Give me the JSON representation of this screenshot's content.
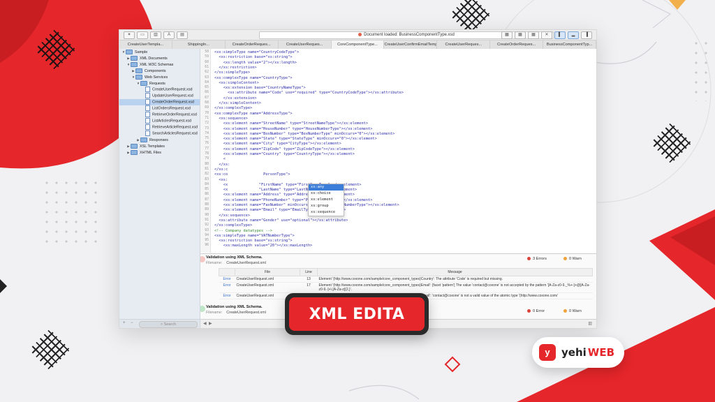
{
  "colors": {
    "accent": "#e5262a",
    "background": "#f1f1f3",
    "selection": "#3b7dd8"
  },
  "window": {
    "doc_status": "Document loaded: BusinessComponentType.xsd",
    "tabs": [
      "CreateUserTempla...",
      "ShippingIn...",
      "CreateOrderReques...",
      "CreateUserReques...",
      "CoreComponentType...",
      "CreateUserConfirmEmailTemplat...",
      "CreateUserReques...",
      "CreateOrderReques...",
      "BusinessComponentTyp..."
    ]
  },
  "sidebar": {
    "tree": [
      {
        "label": "Sample",
        "indent": 0,
        "type": "folder",
        "arrow": "▼"
      },
      {
        "label": "XML Documents",
        "indent": 1,
        "type": "folder",
        "arrow": "▶"
      },
      {
        "label": "XML W3C Schemas",
        "indent": 1,
        "type": "folder",
        "arrow": "▼"
      },
      {
        "label": "Components",
        "indent": 2,
        "type": "folder",
        "arrow": "▶"
      },
      {
        "label": "Web Services",
        "indent": 2,
        "type": "folder",
        "arrow": "▼"
      },
      {
        "label": "Requests",
        "indent": 3,
        "type": "folder",
        "arrow": "▼"
      },
      {
        "label": "CreateUserRequest.xsd",
        "indent": 4,
        "type": "file"
      },
      {
        "label": "UpdateUserRequest.xsd",
        "indent": 4,
        "type": "file"
      },
      {
        "label": "CreateOrderRequest.xsd",
        "indent": 4,
        "type": "file",
        "selected": true
      },
      {
        "label": "ListOrdersRequest.xsd",
        "indent": 4,
        "type": "file"
      },
      {
        "label": "RetrieveOrderRequest.xsd",
        "indent": 4,
        "type": "file"
      },
      {
        "label": "ListArticlesRequest.xsd",
        "indent": 4,
        "type": "file"
      },
      {
        "label": "RetrieveArticleRequest.xsd",
        "indent": 4,
        "type": "file"
      },
      {
        "label": "SearchArticlesRequest.xsd",
        "indent": 4,
        "type": "file"
      },
      {
        "label": "Responses",
        "indent": 3,
        "type": "folder",
        "arrow": "▶"
      },
      {
        "label": "XSL Templates",
        "indent": 1,
        "type": "folder",
        "arrow": "▶"
      },
      {
        "label": "XHTML Files",
        "indent": 1,
        "type": "folder",
        "arrow": "▶"
      }
    ],
    "search_placeholder": "Search"
  },
  "editor": {
    "lines": [
      {
        "n": "58",
        "t": "<xs:simpleType name=\"CountryCodeType\">"
      },
      {
        "n": "59",
        "t": "  <xs:restriction base=\"xs:string\">"
      },
      {
        "n": "60",
        "t": "    <xs:length value=\"2\"></xs:length>"
      },
      {
        "n": "61",
        "t": "  </xs:restriction>"
      },
      {
        "n": "62",
        "t": "</xs:simpleType>"
      },
      {
        "n": "63",
        "t": "<xs:complexType name=\"CountryType\">"
      },
      {
        "n": "64",
        "t": "  <xs:simpleContent>"
      },
      {
        "n": "65",
        "t": "    <xs:extension base=\"CountryNameType\">"
      },
      {
        "n": "66",
        "t": "      <xs:attribute name=\"Code\" use=\"required\" type=\"CountryCodeType\"></xs:attribute>"
      },
      {
        "n": "67",
        "t": "    </xs:extension>"
      },
      {
        "n": "68",
        "t": "  </xs:simpleContent>"
      },
      {
        "n": "69",
        "t": "</xs:complexType>"
      },
      {
        "n": "70",
        "t": "<xs:complexType name=\"AddressType\">"
      },
      {
        "n": "71",
        "t": "  <xs:sequence>"
      },
      {
        "n": "72",
        "t": "    <xs:element name=\"StreetName\" type=\"StreetNameType\"></xs:element>"
      },
      {
        "n": "73",
        "t": "    <xs:element name=\"HouseNumber\" type=\"HouseNumberType\"></xs:element>"
      },
      {
        "n": "74",
        "t": "    <xs:element name=\"BoxNumber\" type=\"BoxNumberType\" minOccurs=\"0\"></xs:element>"
      },
      {
        "n": "75",
        "t": "    <xs:element name=\"State\" type=\"StateType\" minOccurs=\"0\"></xs:element>"
      },
      {
        "n": "76",
        "t": "    <xs:element name=\"City\" type=\"CityType\"></xs:element>"
      },
      {
        "n": "77",
        "t": "    <xs:element name=\"ZipCode\" type=\"ZipCodeType\"></xs:element>"
      },
      {
        "n": "78",
        "t": "    <xs:element name=\"Country\" type=\"CountryType\"></xs:element>"
      },
      {
        "n": "79",
        "t": "    <"
      },
      {
        "n": "80",
        "t": "  </xs:"
      },
      {
        "n": "81",
        "t": "</xs:c"
      },
      {
        "n": "82",
        "t": "<xs:co                PersonType\">"
      },
      {
        "n": "83",
        "t": "  <xs:"
      },
      {
        "n": "84",
        "t": "    <x              \"FirstName\" type=\"FirstNameType\"></xs:element>"
      },
      {
        "n": "85",
        "t": "    <x              \"LastName\" type=\"LastNameType\"></xs:element>"
      },
      {
        "n": "86",
        "t": "    <xs:element name=\"Address\" type=\"AddressType\"></xs:element>"
      },
      {
        "n": "87",
        "t": "    <xs:element name=\"PhoneNumber\" type=\"PhoneNumberType\"></xs:element>"
      },
      {
        "n": "88",
        "t": "    <xs:element name=\"FaxNumber\" minOccurs=\"0\" type=\"PhoneNumberType\"></xs:element>"
      },
      {
        "n": "89",
        "t": "    <xs:element name=\"Email\" type=\"EmailType\"></xs:element>"
      },
      {
        "n": "90",
        "t": "  </xs:sequence>"
      },
      {
        "n": "91",
        "t": "  <xs:attribute name=\"Gender\" use=\"optional\"></xs:attribute>"
      },
      {
        "n": "92",
        "t": "</xs:complexType>"
      },
      {
        "n": "93",
        "t": "<!-- Company datatypes -->"
      },
      {
        "n": "94",
        "t": "<xs:simpleType name=\"VATNumberType\">"
      },
      {
        "n": "95",
        "t": "  <xs:restriction base=\"xs:string\">"
      },
      {
        "n": "96",
        "t": "    <xs:maxLength value=\"20\"></xs:maxLength>"
      }
    ],
    "autocomplete": [
      "xs:any",
      "xs:choice",
      "xs:element",
      "xs:group",
      "xs:sequence"
    ]
  },
  "validation": {
    "title": "Validation using XML Schema.",
    "filename_label": "Filename:",
    "filename": "CreateUserRequest.xml",
    "errors": "3 Errors",
    "warns": "0 Warn",
    "columns": [
      "File",
      "Line",
      "Message"
    ],
    "rows": [
      {
        "type": "Error",
        "file": "CreateUserRequest.xml",
        "line": "13",
        "msg": "Element '{http://www.coxone.com/sample/core_component_types}Country': The attribute 'Code' is required but missing."
      },
      {
        "type": "Error",
        "file": "CreateUserRequest.xml",
        "line": "17",
        "msg": "Element '{http://www.coxone.com/sample/core_component_types}Email': [facet 'pattern'] The value 'contact@coxone' is not accepted by the pattern '[A-Za-z0-9._%+-]+@[A-Za-z0-9.-]+\\.[A-Za-z]{2,}'."
      },
      {
        "type": "Error",
        "file": "CreateUserRequest.xml",
        "line": "17",
        "msg": "Element '{http://www.coxone.com/sample/core_component_types}Email': 'contact@coxone' is not a valid value of the atomic type '{http://www.coxone.com/"
      }
    ],
    "second_title": "Validation using XML Schema.",
    "second_filename": "CreateUserRequest.xml",
    "second_errors": "0 Error",
    "second_warns": "0 Warn"
  },
  "badge": {
    "label": "XML EDITA"
  },
  "brand": {
    "logo": "y",
    "name": "yehi",
    "name_accent": "WEB"
  }
}
